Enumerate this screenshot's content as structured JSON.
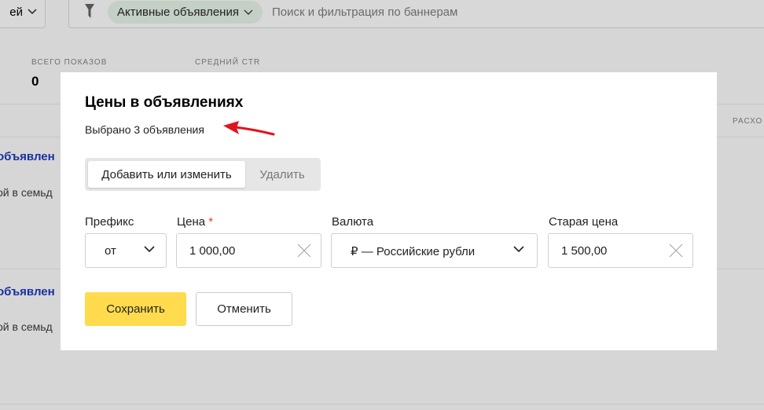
{
  "topbar": {
    "views_label": "ей",
    "filter_chip_label": "Активные объявления",
    "filter_placeholder": "Поиск и фильтрация по баннерам"
  },
  "stats": [
    {
      "label": "ВСЕГО ПОКАЗОВ",
      "value": "0"
    },
    {
      "label": "СРЕДНИЙ CTR",
      "value": ""
    }
  ],
  "table": {
    "right_column_header": "РАСХО"
  },
  "ads": [
    {
      "title": "объявлен",
      "desc": "ой в семьд"
    },
    {
      "title": "объявлен",
      "desc": "ой в семьд"
    }
  ],
  "modal": {
    "title": "Цены в объявлениях",
    "subtitle": "Выбрано 3 объявления",
    "tabs": {
      "active": "Добавить или изменить",
      "inactive": "Удалить"
    },
    "fields": {
      "prefix": {
        "label": "Префикс",
        "value": "от"
      },
      "price": {
        "label": "Цена",
        "required_mark": "*",
        "value": "1 000,00"
      },
      "currency": {
        "label": "Валюта",
        "value": "₽ — Российские рубли"
      },
      "old_price": {
        "label": "Старая цена",
        "value": "1 500,00"
      }
    },
    "save_label": "Сохранить",
    "cancel_label": "Отменить"
  },
  "colors": {
    "overlay_bg": "#d6d6d6",
    "accent_yellow": "#ffdb4d",
    "required_red": "#e53b2c",
    "arrow_red": "#e0141e",
    "link_blue": "#1a2fa0"
  }
}
